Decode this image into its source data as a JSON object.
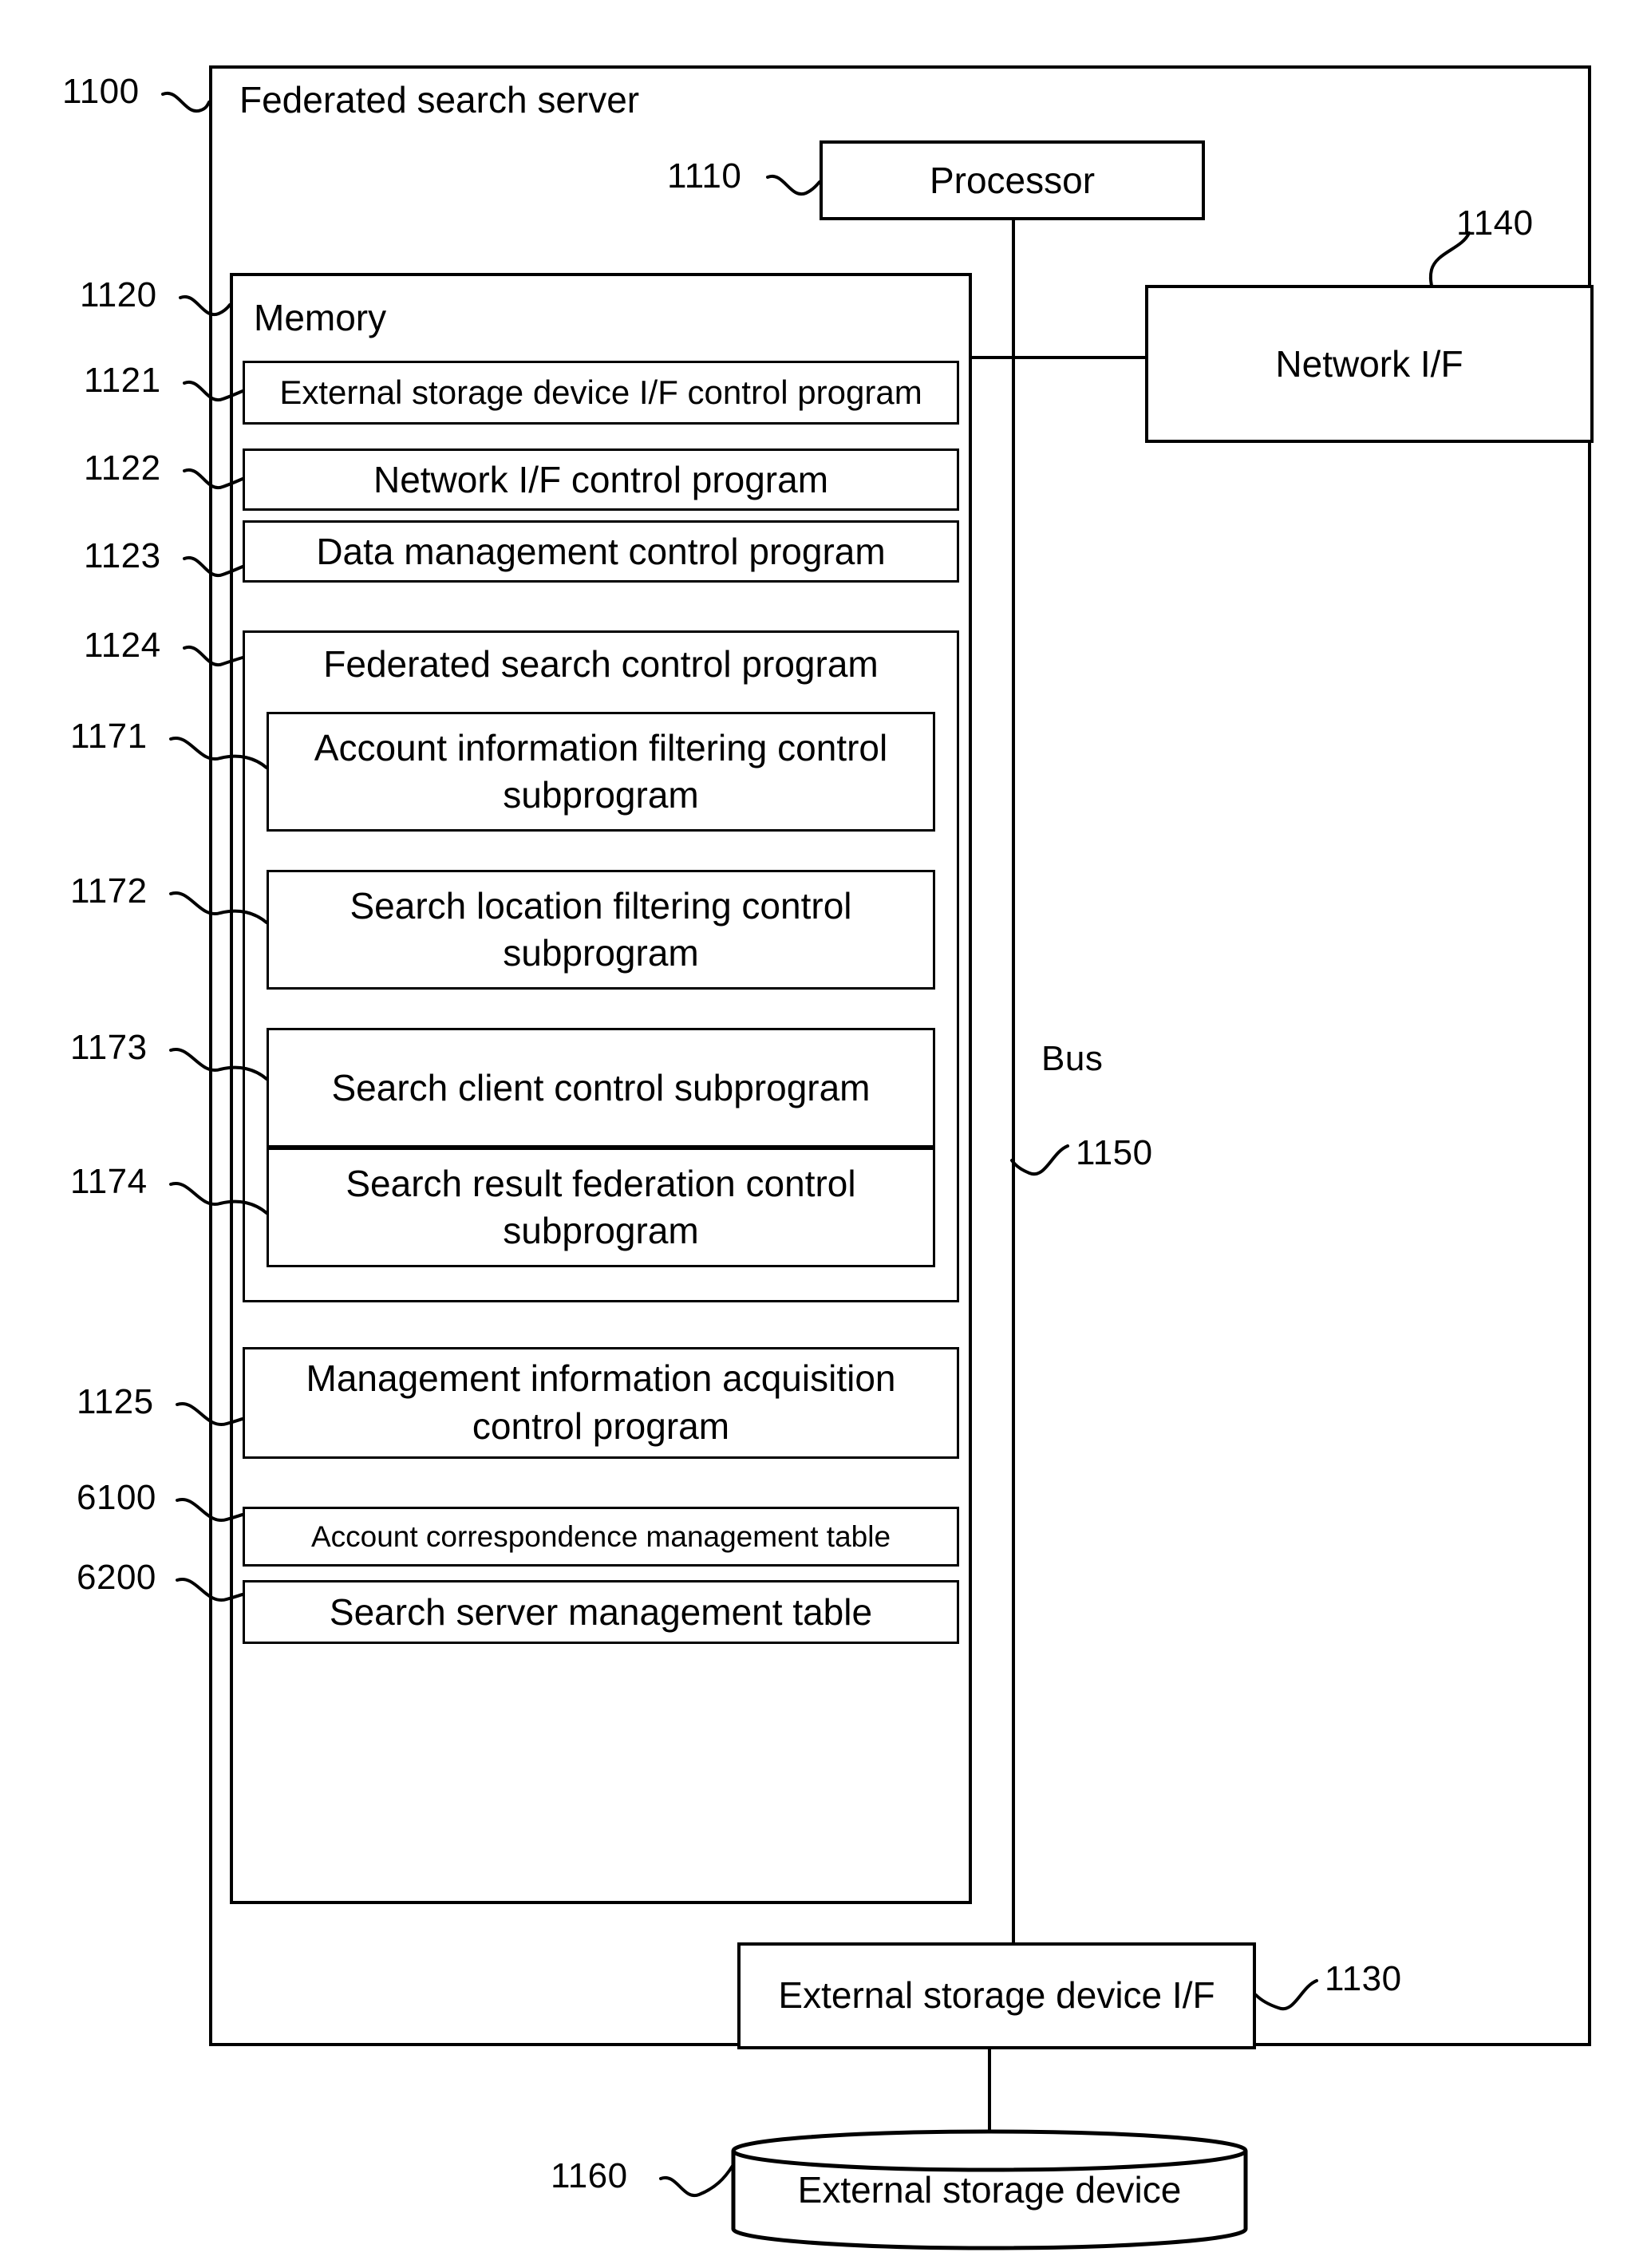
{
  "figure": {
    "type": "block-diagram",
    "title": "Federated search server"
  },
  "server": {
    "ref": "1100",
    "label": "Federated search server"
  },
  "processor": {
    "ref": "1110",
    "label": "Processor"
  },
  "network_if": {
    "ref": "1140",
    "label": "Network I/F"
  },
  "bus": {
    "ref": "1150",
    "label": "Bus"
  },
  "memory": {
    "ref": "1120",
    "label": "Memory",
    "items": [
      {
        "ref": "1121",
        "label": "External storage device I/F control program"
      },
      {
        "ref": "1122",
        "label": "Network I/F control program"
      },
      {
        "ref": "1123",
        "label": "Data management control program"
      }
    ],
    "federated_search_control_program": {
      "ref": "1124",
      "label": "Federated search control program",
      "subprograms": [
        {
          "ref": "1171",
          "label": "Account information filtering control subprogram"
        },
        {
          "ref": "1172",
          "label": "Search location filtering control subprogram"
        },
        {
          "ref": "1173",
          "label": "Search client control subprogram"
        },
        {
          "ref": "1174",
          "label": "Search result federation control subprogram"
        }
      ]
    },
    "tail_items": [
      {
        "ref": "1125",
        "label": "Management information acquisition control program"
      },
      {
        "ref": "6100",
        "label": "Account correspondence management table"
      },
      {
        "ref": "6200",
        "label": "Search server management table"
      }
    ]
  },
  "external_storage_if": {
    "ref": "1130",
    "label": "External storage device I/F"
  },
  "external_storage_device": {
    "ref": "1160",
    "label": "External storage device"
  },
  "colors": {
    "stroke": "#000000",
    "fill": "#ffffff"
  }
}
